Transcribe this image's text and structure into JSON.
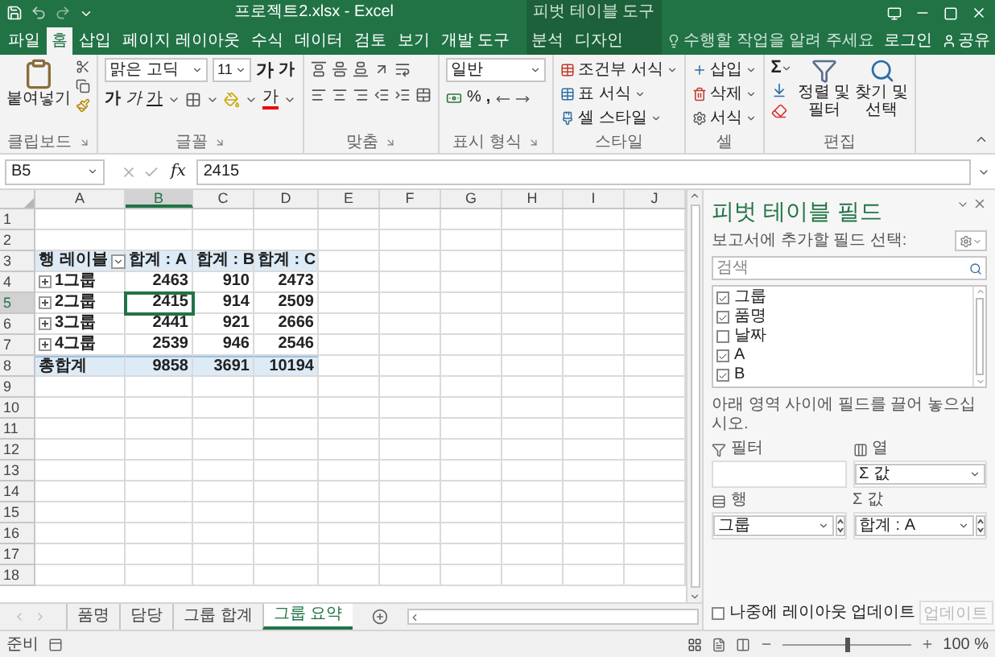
{
  "title_bar": {
    "title": "프로젝트2.xlsx - Excel",
    "context_title": "피벗 테이블 도구"
  },
  "ribbon_tabs": [
    {
      "label": "파일",
      "selected": false,
      "contextual": false
    },
    {
      "label": "홈",
      "selected": true,
      "contextual": false
    },
    {
      "label": "삽입",
      "selected": false,
      "contextual": false
    },
    {
      "label": "페이지 레이아웃",
      "selected": false,
      "contextual": false
    },
    {
      "label": "수식",
      "selected": false,
      "contextual": false
    },
    {
      "label": "데이터",
      "selected": false,
      "contextual": false
    },
    {
      "label": "검토",
      "selected": false,
      "contextual": false
    },
    {
      "label": "보기",
      "selected": false,
      "contextual": false
    },
    {
      "label": "개발 도구",
      "selected": false,
      "contextual": false
    },
    {
      "label": "분석",
      "selected": false,
      "contextual": true
    },
    {
      "label": "디자인",
      "selected": false,
      "contextual": true
    }
  ],
  "tell_me": "수행할 작업을 알려 주세요",
  "account": {
    "login": "로그인",
    "share": "공유"
  },
  "ribbon": {
    "clipboard": {
      "paste": "붙여넣기",
      "label": "클립보드"
    },
    "font": {
      "name": "맑은 고딕",
      "size": "11",
      "grow": "가",
      "shrink": "가",
      "bold": "가",
      "italic": "가",
      "underline": "가",
      "color_letter": "가",
      "label": "글꼴"
    },
    "alignment": {
      "label": "맞춤"
    },
    "number": {
      "format": "일반",
      "percent": "%",
      "comma": ",",
      "label": "표시 형식"
    },
    "styles": {
      "items": [
        "조건부 서식",
        "표 서식",
        "셀 스타일"
      ],
      "label": "스타일"
    },
    "cells": {
      "items": [
        "삽입",
        "삭제",
        "서식"
      ],
      "label": "셀"
    },
    "editing": {
      "sum": "Σ",
      "sort": [
        "정렬 및",
        "필터"
      ],
      "find": [
        "찾기 및",
        "선택"
      ],
      "label": "편집"
    }
  },
  "formula_bar": {
    "name_box": "B5",
    "fx": "fx",
    "value": "2415"
  },
  "sheet": {
    "columns": [
      {
        "label": "A",
        "selected": false
      },
      {
        "label": "B",
        "selected": true
      },
      {
        "label": "C",
        "selected": false
      },
      {
        "label": "D",
        "selected": false
      },
      {
        "label": "E",
        "selected": false
      },
      {
        "label": "F",
        "selected": false
      },
      {
        "label": "G",
        "selected": false
      },
      {
        "label": "H",
        "selected": false
      },
      {
        "label": "I",
        "selected": false
      },
      {
        "label": "J",
        "selected": false
      }
    ],
    "rows": [
      {
        "number": "1",
        "selected": false,
        "kind": "empty"
      },
      {
        "number": "2",
        "selected": false,
        "kind": "empty"
      },
      {
        "number": "3",
        "selected": false,
        "kind": "header",
        "cells": [
          "행 레이블",
          "합계 : A",
          "합계 : B",
          "합계 : C"
        ]
      },
      {
        "number": "4",
        "selected": false,
        "kind": "item",
        "cells": [
          "1그룹",
          "2463",
          "910",
          "2473"
        ]
      },
      {
        "number": "5",
        "selected": true,
        "kind": "item",
        "cells": [
          "2그룹",
          "2415",
          "914",
          "2509"
        ]
      },
      {
        "number": "6",
        "selected": false,
        "kind": "item",
        "cells": [
          "3그룹",
          "2441",
          "921",
          "2666"
        ]
      },
      {
        "number": "7",
        "selected": false,
        "kind": "item",
        "cells": [
          "4그룹",
          "2539",
          "946",
          "2546"
        ]
      },
      {
        "number": "8",
        "selected": false,
        "kind": "total",
        "cells": [
          "총합계",
          "9858",
          "3691",
          "10194"
        ]
      },
      {
        "number": "9",
        "selected": false,
        "kind": "empty"
      },
      {
        "number": "10",
        "selected": false,
        "kind": "empty"
      },
      {
        "number": "11",
        "selected": false,
        "kind": "empty"
      },
      {
        "number": "12",
        "selected": false,
        "kind": "empty"
      },
      {
        "number": "13",
        "selected": false,
        "kind": "empty"
      },
      {
        "number": "14",
        "selected": false,
        "kind": "empty"
      },
      {
        "number": "15",
        "selected": false,
        "kind": "empty"
      },
      {
        "number": "16",
        "selected": false,
        "kind": "empty"
      },
      {
        "number": "17",
        "selected": false,
        "kind": "empty"
      },
      {
        "number": "18",
        "selected": false,
        "kind": "empty"
      }
    ]
  },
  "sheet_tabs": [
    {
      "label": "품명",
      "selected": false
    },
    {
      "label": "담당",
      "selected": false
    },
    {
      "label": "그룹 합계",
      "selected": false
    },
    {
      "label": "그룹 요약",
      "selected": true
    }
  ],
  "pivot_pane": {
    "title": "피벗 테이블 필드",
    "subtitle": "보고서에 추가할 필드 선택:",
    "search_placeholder": "검색",
    "fields": [
      {
        "label": "그룹",
        "checked": true
      },
      {
        "label": "품명",
        "checked": true
      },
      {
        "label": "날짜",
        "checked": false
      },
      {
        "label": "A",
        "checked": true
      },
      {
        "label": "B",
        "checked": true
      }
    ],
    "hint": "아래 영역 사이에 필드를 끌어 놓으십시오.",
    "areas": [
      {
        "kind": "filter",
        "label": "필터"
      },
      {
        "kind": "columns",
        "label": "열",
        "items": [
          "Σ 값"
        ]
      },
      {
        "kind": "rows",
        "label": "행",
        "items": [
          "그룹"
        ]
      },
      {
        "kind": "values",
        "label": "Σ 값",
        "items": [
          "합계 : A"
        ]
      }
    ],
    "defer": {
      "label": "나중에 레이아웃 업데이트",
      "checked": false
    },
    "update_button": {
      "label": "업데이트",
      "disabled": true
    }
  },
  "status_bar": {
    "status": "준비",
    "zoom": "100 %",
    "zoom_slider": {
      "level": 0.5
    }
  }
}
